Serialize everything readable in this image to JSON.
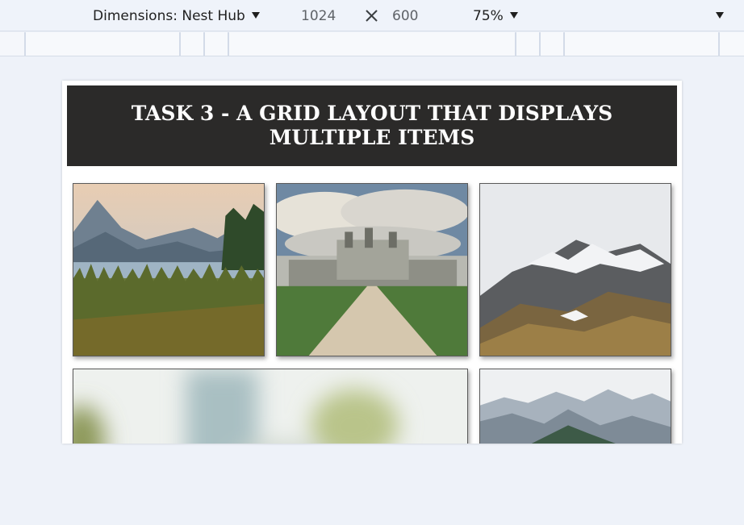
{
  "toolbar": {
    "device_label": "Dimensions: Nest Hub",
    "width_value": "1024",
    "height_value": "600",
    "zoom_label": "75%",
    "icons": {
      "device_caret": "caret-down-icon",
      "times": "times-icon",
      "zoom_caret": "caret-down-icon",
      "more_caret": "caret-down-icon"
    }
  },
  "page": {
    "title": "TASK 3 - A GRID LAYOUT THAT DISPLAYS MULTIPLE ITEMS",
    "header_bg": "#2b2a29",
    "header_fg": "#ffffff",
    "gallery": [
      {
        "name": "lake-reeds-photo"
      },
      {
        "name": "castle-avenue-photo"
      },
      {
        "name": "snowy-mountain-photo"
      },
      {
        "name": "blurred-wide-photo"
      },
      {
        "name": "mountain-range-photo"
      }
    ]
  }
}
